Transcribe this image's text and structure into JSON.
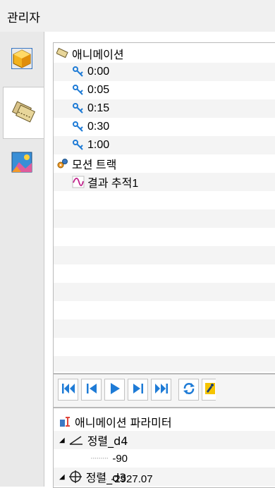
{
  "header": {
    "title": "관리자"
  },
  "left_tabs": [
    {
      "name": "part-tab",
      "icon": "cube-icon"
    },
    {
      "name": "animation-tab",
      "icon": "film-icon"
    },
    {
      "name": "rendering-tab",
      "icon": "landscape-icon"
    }
  ],
  "tree": {
    "root_label": "애니메이션",
    "keyframes": [
      "0:00",
      "0:05",
      "0:15",
      "0:30",
      "1:00"
    ],
    "motion_track_label": "모션 트랙",
    "result_trace_label": "결과 추적1"
  },
  "toolbar": {
    "buttons": [
      "go-to-start",
      "step-back",
      "play",
      "step-forward",
      "go-to-end",
      "loop",
      "record"
    ]
  },
  "params": {
    "header_label": "애니메이션 파라미터",
    "items": [
      {
        "name": "정렬_d4",
        "value": "-90",
        "icon": "angle-icon"
      },
      {
        "name": "정렬_d3",
        "value": "-2927.07",
        "icon": "crosshair-icon"
      }
    ]
  },
  "colors": {
    "accent_blue": "#1e7bd6",
    "magenta": "#c0208a",
    "panel_border": "#b9b9b9"
  }
}
